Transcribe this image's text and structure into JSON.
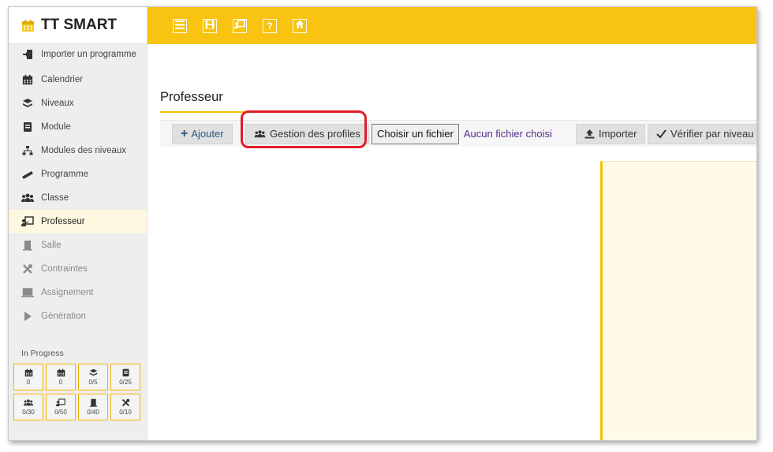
{
  "app": {
    "brand": "TT SMART",
    "brand_icon": "calendar-icon",
    "accent": "#f8c311",
    "highlight_color": "#e01c2b"
  },
  "topbar": {
    "buttons": [
      {
        "name": "menu-icon"
      },
      {
        "name": "save-icon"
      },
      {
        "name": "teacher-icon"
      },
      {
        "name": "help-icon"
      },
      {
        "name": "home-icon"
      }
    ],
    "help_glyph": "?"
  },
  "sidebar": {
    "items": [
      {
        "label": "Importer un programme",
        "icon": "import-icon",
        "state": "normal"
      },
      {
        "label": "Calendrier",
        "icon": "calendar-icon",
        "state": "normal"
      },
      {
        "label": "Niveaux",
        "icon": "layers-icon",
        "state": "normal"
      },
      {
        "label": "Module",
        "icon": "module-icon",
        "state": "normal"
      },
      {
        "label": "Modules des niveaux",
        "icon": "sitemap-icon",
        "state": "normal"
      },
      {
        "label": "Programme",
        "icon": "ruler-icon",
        "state": "normal"
      },
      {
        "label": "Classe",
        "icon": "users-icon",
        "state": "normal"
      },
      {
        "label": "Professeur",
        "icon": "teacher-icon",
        "state": "active"
      },
      {
        "label": "Salle",
        "icon": "door-icon",
        "state": "disabled"
      },
      {
        "label": "Contraintes",
        "icon": "tools-icon",
        "state": "disabled"
      },
      {
        "label": "Assignement",
        "icon": "laptop-icon",
        "state": "disabled"
      },
      {
        "label": "Génération",
        "icon": "play-icon",
        "state": "disabled"
      }
    ],
    "progress": {
      "title": "In Progress",
      "cells": [
        {
          "icon": "calendar-icon",
          "value": "0"
        },
        {
          "icon": "calendar-icon",
          "value": "0"
        },
        {
          "icon": "layers-icon",
          "value": "0/5"
        },
        {
          "icon": "module-icon",
          "value": "0/25"
        },
        {
          "icon": "users-icon",
          "value": "0/30"
        },
        {
          "icon": "teacher-icon",
          "value": "0/50"
        },
        {
          "icon": "door-icon",
          "value": "0/40"
        },
        {
          "icon": "tools-icon",
          "value": "0/10"
        }
      ]
    }
  },
  "main": {
    "title": "Professeur",
    "toolbar": {
      "add_label": "Ajouter",
      "profiles_label": "Gestion des profiles",
      "file_button_label": "Choisir un fichier",
      "file_status": "Aucun fichier choisi",
      "import_label": "Importer",
      "verify_label": "Vérifier par niveau"
    }
  }
}
